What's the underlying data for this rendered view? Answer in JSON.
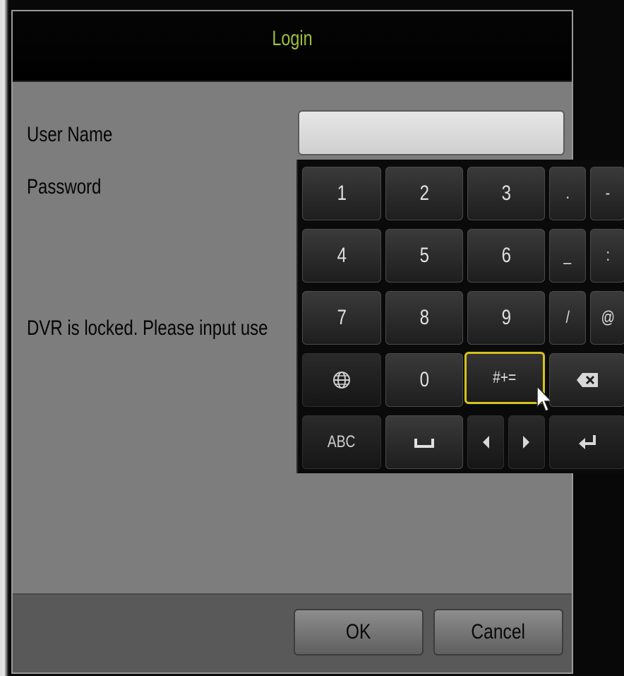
{
  "dialog": {
    "title": "Login",
    "username_label": "User Name",
    "password_label": "Password",
    "username_value": "",
    "locked_message": "DVR is locked. Please input use",
    "ok_label": "OK",
    "cancel_label": "Cancel",
    "title_color": "#9fbf3a"
  },
  "keyboard": {
    "row1": [
      "1",
      "2",
      "3",
      ".",
      "-"
    ],
    "row2": [
      "4",
      "5",
      "6",
      "_",
      ":"
    ],
    "row3": [
      "7",
      "8",
      "9",
      "/",
      "@"
    ],
    "row4": {
      "globe": "globe-icon",
      "zero": "0",
      "symbols": "#+=",
      "backspace": "backspace-icon"
    },
    "row5": {
      "abc": "ABC",
      "space": "space-icon",
      "left": "arrow-left-icon",
      "right": "arrow-right-icon",
      "enter": "enter-icon"
    },
    "selected_key": "#+=",
    "highlight_color": "#d6c21c"
  }
}
